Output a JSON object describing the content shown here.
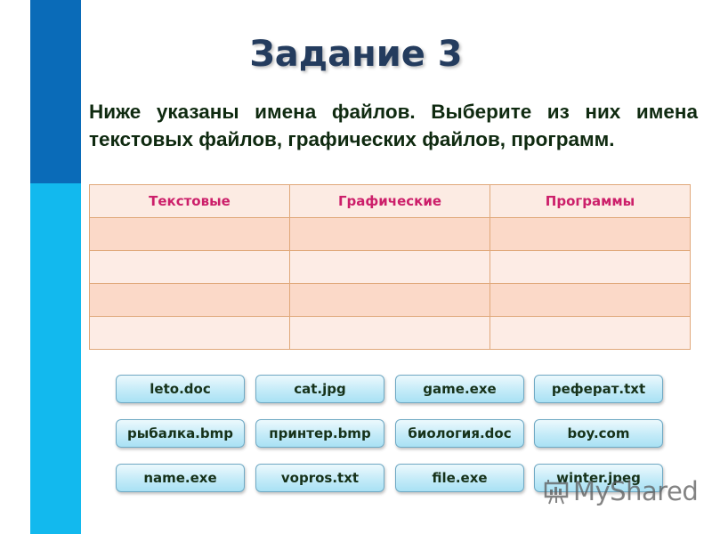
{
  "slide": {
    "title": "Задание 3",
    "instructions": "Ниже указаны имена файлов. Выберите из них имена текстовых файлов,  графических файлов, программ.",
    "colors": {
      "stripe_dark": "#0a6bb8",
      "stripe_light": "#12b9ee",
      "title": "#243c5e",
      "header_text": "#cc1f6a",
      "instruction_text": "#0f2a10"
    }
  },
  "table": {
    "headers": [
      "Текстовые",
      "Графические",
      "Программы"
    ],
    "rows": [
      [
        "",
        "",
        ""
      ],
      [
        "",
        "",
        ""
      ],
      [
        "",
        "",
        ""
      ],
      [
        "",
        "",
        ""
      ]
    ]
  },
  "files": [
    [
      "leto.doc",
      "cat.jpg",
      "game.exe",
      "реферат.txt"
    ],
    [
      "рыбалка.bmp",
      "принтер.bmp",
      "биология.doc",
      "boy.com"
    ],
    [
      "name.exe",
      "vopros.txt",
      "file.exe",
      "winter.jpeg"
    ]
  ],
  "watermark": {
    "icon": "presentation-board-icon",
    "text": "MyShared"
  }
}
